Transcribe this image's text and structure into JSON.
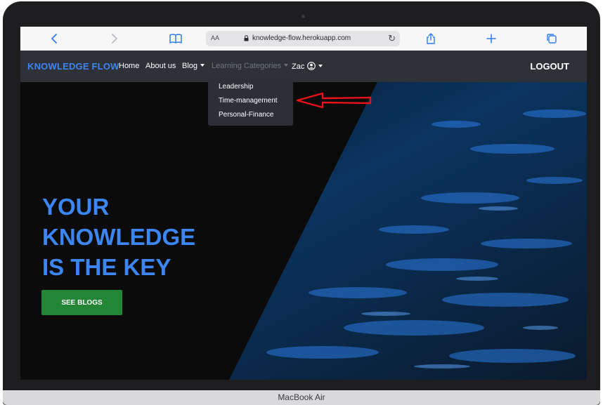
{
  "device": {
    "label": "MacBook Air"
  },
  "browser": {
    "text_size_label": "AA",
    "url": "knowledge-flow.herokuapp.com",
    "icons": [
      "back-icon",
      "forward-icon",
      "bookmarks-icon",
      "lock-icon",
      "reload-icon",
      "share-icon",
      "new-tab-icon",
      "tabs-icon"
    ]
  },
  "site": {
    "brand": "KNOWLEDGE FLOW",
    "nav": {
      "home": "Home",
      "about": "About us",
      "blog": "Blog",
      "categories": "Learning Categories",
      "user": "Zac",
      "logout": "LOGOUT"
    },
    "dropdown": {
      "items": [
        "Leadership",
        "Time-management",
        "Personal-Finance"
      ]
    },
    "hero": {
      "line1": "YOUR",
      "line2": "KNOWLEDGE",
      "line3": "IS THE KEY",
      "cta": "SEE BLOGS"
    }
  },
  "colors": {
    "brand": "#3e84f3",
    "navbar": "#2e3238",
    "cta": "#238536",
    "arrow": "#e8121a"
  }
}
